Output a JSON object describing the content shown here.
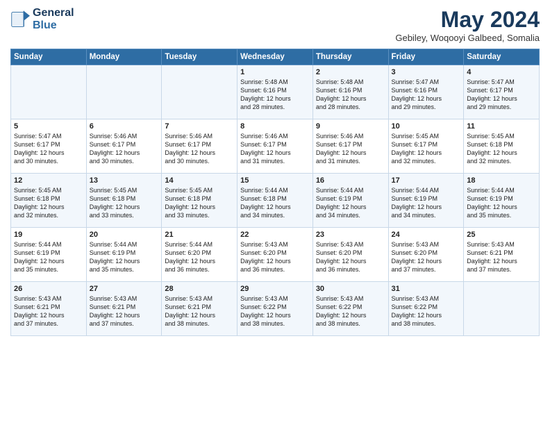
{
  "logo": {
    "line1": "General",
    "line2": "Blue"
  },
  "title": "May 2024",
  "subtitle": "Gebiley, Woqooyi Galbeed, Somalia",
  "weekdays": [
    "Sunday",
    "Monday",
    "Tuesday",
    "Wednesday",
    "Thursday",
    "Friday",
    "Saturday"
  ],
  "weeks": [
    [
      {
        "day": "",
        "detail": ""
      },
      {
        "day": "",
        "detail": ""
      },
      {
        "day": "",
        "detail": ""
      },
      {
        "day": "1",
        "detail": "Sunrise: 5:48 AM\nSunset: 6:16 PM\nDaylight: 12 hours\nand 28 minutes."
      },
      {
        "day": "2",
        "detail": "Sunrise: 5:48 AM\nSunset: 6:16 PM\nDaylight: 12 hours\nand 28 minutes."
      },
      {
        "day": "3",
        "detail": "Sunrise: 5:47 AM\nSunset: 6:16 PM\nDaylight: 12 hours\nand 29 minutes."
      },
      {
        "day": "4",
        "detail": "Sunrise: 5:47 AM\nSunset: 6:17 PM\nDaylight: 12 hours\nand 29 minutes."
      }
    ],
    [
      {
        "day": "5",
        "detail": "Sunrise: 5:47 AM\nSunset: 6:17 PM\nDaylight: 12 hours\nand 30 minutes."
      },
      {
        "day": "6",
        "detail": "Sunrise: 5:46 AM\nSunset: 6:17 PM\nDaylight: 12 hours\nand 30 minutes."
      },
      {
        "day": "7",
        "detail": "Sunrise: 5:46 AM\nSunset: 6:17 PM\nDaylight: 12 hours\nand 30 minutes."
      },
      {
        "day": "8",
        "detail": "Sunrise: 5:46 AM\nSunset: 6:17 PM\nDaylight: 12 hours\nand 31 minutes."
      },
      {
        "day": "9",
        "detail": "Sunrise: 5:46 AM\nSunset: 6:17 PM\nDaylight: 12 hours\nand 31 minutes."
      },
      {
        "day": "10",
        "detail": "Sunrise: 5:45 AM\nSunset: 6:17 PM\nDaylight: 12 hours\nand 32 minutes."
      },
      {
        "day": "11",
        "detail": "Sunrise: 5:45 AM\nSunset: 6:18 PM\nDaylight: 12 hours\nand 32 minutes."
      }
    ],
    [
      {
        "day": "12",
        "detail": "Sunrise: 5:45 AM\nSunset: 6:18 PM\nDaylight: 12 hours\nand 32 minutes."
      },
      {
        "day": "13",
        "detail": "Sunrise: 5:45 AM\nSunset: 6:18 PM\nDaylight: 12 hours\nand 33 minutes."
      },
      {
        "day": "14",
        "detail": "Sunrise: 5:45 AM\nSunset: 6:18 PM\nDaylight: 12 hours\nand 33 minutes."
      },
      {
        "day": "15",
        "detail": "Sunrise: 5:44 AM\nSunset: 6:18 PM\nDaylight: 12 hours\nand 34 minutes."
      },
      {
        "day": "16",
        "detail": "Sunrise: 5:44 AM\nSunset: 6:19 PM\nDaylight: 12 hours\nand 34 minutes."
      },
      {
        "day": "17",
        "detail": "Sunrise: 5:44 AM\nSunset: 6:19 PM\nDaylight: 12 hours\nand 34 minutes."
      },
      {
        "day": "18",
        "detail": "Sunrise: 5:44 AM\nSunset: 6:19 PM\nDaylight: 12 hours\nand 35 minutes."
      }
    ],
    [
      {
        "day": "19",
        "detail": "Sunrise: 5:44 AM\nSunset: 6:19 PM\nDaylight: 12 hours\nand 35 minutes."
      },
      {
        "day": "20",
        "detail": "Sunrise: 5:44 AM\nSunset: 6:19 PM\nDaylight: 12 hours\nand 35 minutes."
      },
      {
        "day": "21",
        "detail": "Sunrise: 5:44 AM\nSunset: 6:20 PM\nDaylight: 12 hours\nand 36 minutes."
      },
      {
        "day": "22",
        "detail": "Sunrise: 5:43 AM\nSunset: 6:20 PM\nDaylight: 12 hours\nand 36 minutes."
      },
      {
        "day": "23",
        "detail": "Sunrise: 5:43 AM\nSunset: 6:20 PM\nDaylight: 12 hours\nand 36 minutes."
      },
      {
        "day": "24",
        "detail": "Sunrise: 5:43 AM\nSunset: 6:20 PM\nDaylight: 12 hours\nand 37 minutes."
      },
      {
        "day": "25",
        "detail": "Sunrise: 5:43 AM\nSunset: 6:21 PM\nDaylight: 12 hours\nand 37 minutes."
      }
    ],
    [
      {
        "day": "26",
        "detail": "Sunrise: 5:43 AM\nSunset: 6:21 PM\nDaylight: 12 hours\nand 37 minutes."
      },
      {
        "day": "27",
        "detail": "Sunrise: 5:43 AM\nSunset: 6:21 PM\nDaylight: 12 hours\nand 37 minutes."
      },
      {
        "day": "28",
        "detail": "Sunrise: 5:43 AM\nSunset: 6:21 PM\nDaylight: 12 hours\nand 38 minutes."
      },
      {
        "day": "29",
        "detail": "Sunrise: 5:43 AM\nSunset: 6:22 PM\nDaylight: 12 hours\nand 38 minutes."
      },
      {
        "day": "30",
        "detail": "Sunrise: 5:43 AM\nSunset: 6:22 PM\nDaylight: 12 hours\nand 38 minutes."
      },
      {
        "day": "31",
        "detail": "Sunrise: 5:43 AM\nSunset: 6:22 PM\nDaylight: 12 hours\nand 38 minutes."
      },
      {
        "day": "",
        "detail": ""
      }
    ]
  ]
}
